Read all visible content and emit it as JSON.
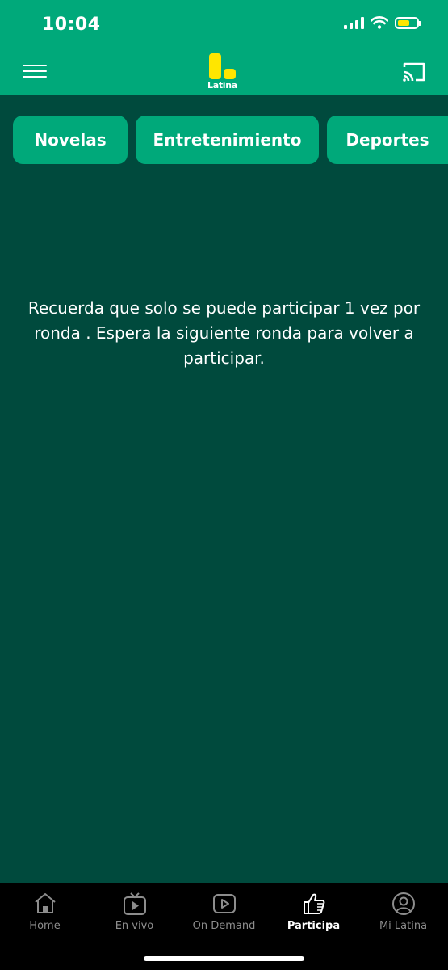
{
  "status_bar": {
    "time": "10:04",
    "battery_color": "#ffe600"
  },
  "header": {
    "logo_text": "Latina",
    "menu_icon": "hamburger-icon",
    "cast_icon": "cast-icon"
  },
  "tabs": [
    {
      "label": "Novelas"
    },
    {
      "label": "Entretenimiento"
    },
    {
      "label": "Deportes"
    }
  ],
  "message": "Recuerda que solo se puede participar 1 vez por ronda . Espera la siguiente ronda para volver a participar.",
  "bottom_nav": [
    {
      "label": "Home",
      "icon": "home-icon"
    },
    {
      "label": "En vivo",
      "icon": "tv-icon"
    },
    {
      "label": "On Demand",
      "icon": "play-icon"
    },
    {
      "label": "Participa",
      "icon": "thumbs-up-icon",
      "active": true
    },
    {
      "label": "Mi Latina",
      "icon": "user-icon"
    }
  ],
  "colors": {
    "header_bg": "#00a97a",
    "body_bg": "#004a3d",
    "accent": "#ffe600"
  }
}
